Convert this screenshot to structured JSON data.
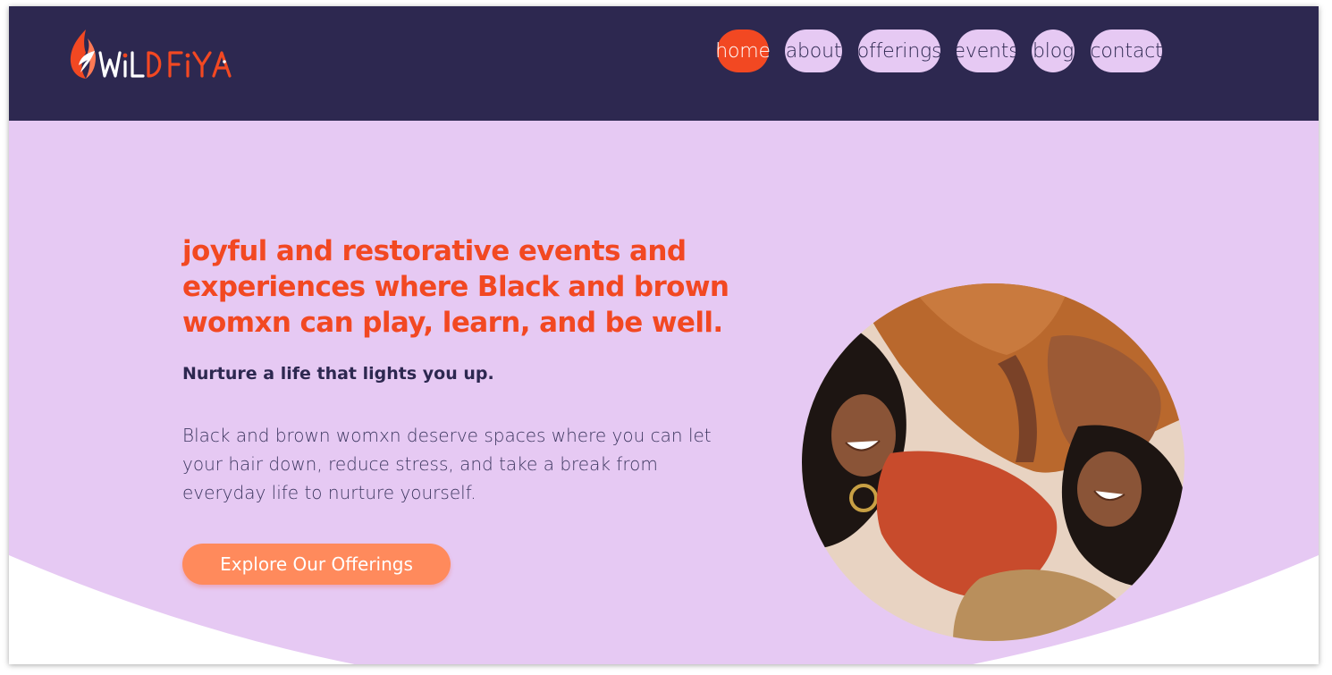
{
  "header": {
    "logo_text": "WiLDFiYA",
    "nav": [
      {
        "label": "home",
        "active": true
      },
      {
        "label": "about",
        "active": false
      },
      {
        "label": "offerings",
        "active": false
      },
      {
        "label": "events",
        "active": false
      },
      {
        "label": "blog",
        "active": false
      },
      {
        "label": "contact",
        "active": false
      }
    ]
  },
  "hero": {
    "headline": "joyful and restorative events and experiences where Black and brown womxn can play, learn, and be well.",
    "subheadline": "Nurture a life that lights you up.",
    "body": "Black and brown womxn deserve spaces where you can let your hair down, reduce stress, and take a break from everyday life to nurture yourself.",
    "cta_label": "Explore Our Offerings",
    "image_icon": "photo-two-women-laughing"
  },
  "colors": {
    "header_bg": "#2d2850",
    "hero_bg": "#e6c9f3",
    "accent": "#f24822",
    "cta": "#ff8a5c",
    "nav_pill": "#e6c9f3"
  }
}
